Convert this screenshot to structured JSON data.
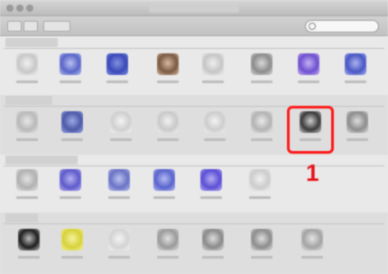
{
  "callout": {
    "label": "1",
    "color": "#e8141c"
  },
  "sections": [
    {
      "key": "personal",
      "items": [
        {
          "name": "pref-item",
          "icon": "general-icon",
          "color": "#c8c8c8",
          "accent": "#f0f0f0"
        },
        {
          "name": "pref-item",
          "icon": "desktop-icon",
          "color": "#5a66c8",
          "accent": "#b9c1f2"
        },
        {
          "name": "pref-item",
          "icon": "dock-icon",
          "color": "#3b49b8",
          "accent": "#8090e0"
        },
        {
          "name": "pref-item",
          "icon": "mission-control-icon",
          "color": "#7a5a44",
          "accent": "#d9b89e"
        },
        {
          "name": "pref-item",
          "icon": "language-icon",
          "color": "#c6c6c6",
          "accent": "#eeeeee"
        },
        {
          "name": "pref-item",
          "icon": "security-icon",
          "color": "#8c8c8c",
          "accent": "#d8d8d8"
        },
        {
          "name": "pref-item",
          "icon": "spotlight-icon",
          "color": "#6f4fd0",
          "accent": "#c3b2f2"
        },
        {
          "name": "pref-item",
          "icon": "notifications-icon",
          "color": "#4a57c4",
          "accent": "#a9b2ef"
        }
      ]
    },
    {
      "key": "hardware",
      "items": [
        {
          "name": "pref-item",
          "icon": "displays-icon",
          "color": "#b9b9b9",
          "accent": "#e6e6e6"
        },
        {
          "name": "pref-item",
          "icon": "energy-icon",
          "color": "#4d5aa8",
          "accent": "#9ca8e4"
        },
        {
          "name": "pref-item",
          "icon": "keyboard-icon",
          "color": "#cfcfcf",
          "accent": "#f4f4f4"
        },
        {
          "name": "pref-item",
          "icon": "mouse-icon",
          "color": "#c9c9c9",
          "accent": "#f1f1f1"
        },
        {
          "name": "pref-item",
          "icon": "trackpad-icon",
          "color": "#cdcdcd",
          "accent": "#f2f2f2"
        },
        {
          "name": "pref-item",
          "icon": "printers-icon",
          "color": "#b3b3b3",
          "accent": "#e9e9e9"
        },
        {
          "name": "pref-item",
          "icon": "sound-icon",
          "color": "#3a3a3a",
          "accent": "#cfcfcf"
        },
        {
          "name": "pref-item",
          "icon": "startup-disk-icon",
          "color": "#8d8d8d",
          "accent": "#dcdcdc"
        }
      ]
    },
    {
      "key": "internet",
      "items": [
        {
          "name": "pref-item",
          "icon": "icloud-icon",
          "color": "#b1b1b1",
          "accent": "#e3e3e3"
        },
        {
          "name": "pref-item",
          "icon": "internet-accounts-icon",
          "color": "#5e5acb",
          "accent": "#b5b2f0"
        },
        {
          "name": "pref-item",
          "icon": "network-icon",
          "color": "#6973c4",
          "accent": "#bcc3ef"
        },
        {
          "name": "pref-item",
          "icon": "bluetooth-icon",
          "color": "#5a64cc",
          "accent": "#b4bbf1"
        },
        {
          "name": "pref-item",
          "icon": "sharing-icon",
          "color": "#5b4fd4",
          "accent": "#b6adf3"
        },
        {
          "name": "pref-item",
          "icon": "extensions-icon",
          "color": "#cccccc",
          "accent": "#f0f0f0"
        }
      ]
    },
    {
      "key": "system",
      "items": [
        {
          "name": "pref-item",
          "icon": "users-icon",
          "color": "#1f1f1f",
          "accent": "#bdbdbd"
        },
        {
          "name": "pref-item",
          "icon": "parental-controls-icon",
          "color": "#d6d23a",
          "accent": "#f6f2a0"
        },
        {
          "name": "pref-item",
          "icon": "app-store-icon",
          "color": "#d3d3d3",
          "accent": "#f4f4f4"
        },
        {
          "name": "pref-item",
          "icon": "dictation-icon",
          "color": "#9a9a9a",
          "accent": "#e0e0e0"
        },
        {
          "name": "pref-item",
          "icon": "date-time-icon",
          "color": "#8a8a8a",
          "accent": "#dddddd"
        },
        {
          "name": "pref-item",
          "icon": "time-machine-icon",
          "color": "#8c8c8c",
          "accent": "#dedede"
        },
        {
          "name": "pref-item",
          "icon": "accessibility-icon",
          "color": "#a3a3a3",
          "accent": "#e4e4e4"
        }
      ]
    }
  ]
}
